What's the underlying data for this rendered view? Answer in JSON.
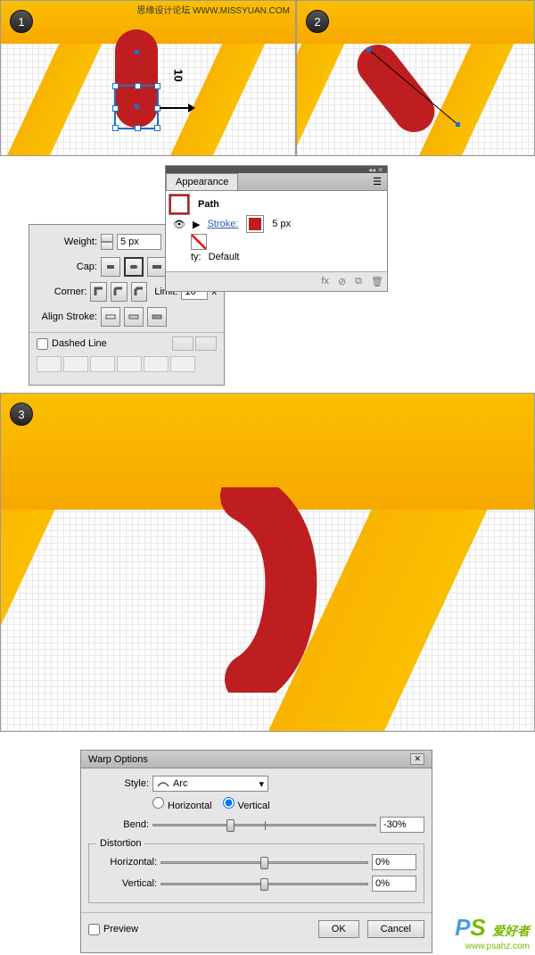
{
  "watermark_top": "思缘设计论坛  WWW.MISSYUAN.COM",
  "steps": {
    "s1": "1",
    "s2": "2",
    "s3": "3"
  },
  "canvas1": {
    "measure": "10"
  },
  "stroke_panel": {
    "weight_label": "Weight:",
    "weight_value": "5 px",
    "cap_label": "Cap:",
    "corner_label": "Corner:",
    "limit_label": "Limit:",
    "limit_value": "10",
    "limit_suffix": "x",
    "align_label": "Align Stroke:",
    "dashed_label": "Dashed Line"
  },
  "appearance_panel": {
    "tab": "Appearance",
    "item_title": "Path",
    "stroke_label": "Stroke:",
    "stroke_val": "5 px",
    "opacity_label": "ty:",
    "opacity_val": "Default"
  },
  "warp_panel": {
    "title": "Warp Options",
    "style_label": "Style:",
    "style_value": "Arc",
    "orient_h": "Horizontal",
    "orient_v": "Vertical",
    "bend_label": "Bend:",
    "bend_value": "-30%",
    "distortion_legend": "Distortion",
    "dist_h_label": "Horizontal:",
    "dist_h_value": "0%",
    "dist_v_label": "Vertical:",
    "dist_v_value": "0%",
    "preview_label": "Preview",
    "ok": "OK",
    "cancel": "Cancel"
  },
  "watermark_bot": {
    "brand_p": "P",
    "brand_s": "S",
    "sub": "爱好者",
    "url": "www.psahz.com"
  }
}
